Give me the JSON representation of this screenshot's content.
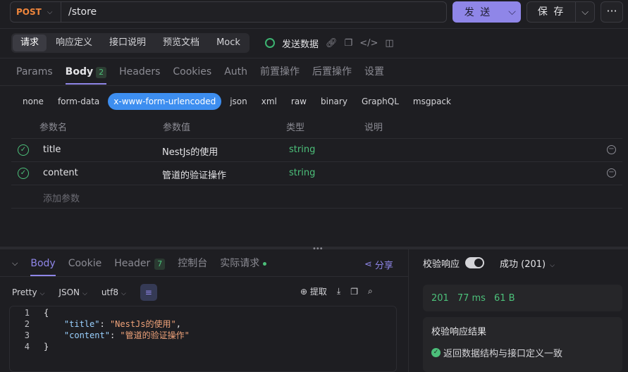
{
  "request": {
    "method": "POST",
    "url": "/store",
    "send_label": "发 送",
    "save_label": "保 存",
    "more_label": "···"
  },
  "top_tabs": [
    "请求",
    "响应定义",
    "接口说明",
    "预览文档",
    "Mock"
  ],
  "actions": {
    "send_data": "发送数据"
  },
  "request_tabs": [
    {
      "label": "Params"
    },
    {
      "label": "Body",
      "count": "2"
    },
    {
      "label": "Headers"
    },
    {
      "label": "Cookies"
    },
    {
      "label": "Auth"
    },
    {
      "label": "前置操作"
    },
    {
      "label": "后置操作"
    },
    {
      "label": "设置"
    }
  ],
  "body_types": [
    "none",
    "form-data",
    "x-www-form-urlencoded",
    "json",
    "xml",
    "raw",
    "binary",
    "GraphQL",
    "msgpack"
  ],
  "params_table": {
    "headers": [
      "参数名",
      "参数值",
      "类型",
      "说明"
    ],
    "rows": [
      {
        "name": "title",
        "value": "NestJs的使用",
        "type": "string"
      },
      {
        "name": "content",
        "value": "管道的验证操作",
        "type": "string"
      }
    ],
    "add_placeholder": "添加参数"
  },
  "response_tabs": [
    {
      "label": "Body"
    },
    {
      "label": "Cookie"
    },
    {
      "label": "Header",
      "count": "7"
    },
    {
      "label": "控制台"
    },
    {
      "label": "实际请求"
    }
  ],
  "share_label": "分享",
  "format": {
    "pretty": "Pretty",
    "lang": "JSON",
    "encoding": "utf8"
  },
  "extract_label": "提取",
  "code": {
    "line_numbers": [
      "1",
      "2",
      "3",
      "4"
    ],
    "open_brace": "{",
    "close_brace": "}",
    "key1": "\"title\"",
    "val1": "\"NestJs的使用\"",
    "key2": "\"content\"",
    "val2": "\"管道的验证操作\""
  },
  "validation": {
    "label": "校验响应",
    "status": "成功 (201)",
    "stats": {
      "code": "201",
      "time": "77 ms",
      "size": "61 B"
    },
    "result_title": "校验响应结果",
    "result_message": "返回数据结构与接口定义一致"
  },
  "colors": {
    "accent": "#8f86e8",
    "success": "#4cc07a",
    "method": "#f0863c",
    "active_body_type": "#3d8ef0"
  }
}
